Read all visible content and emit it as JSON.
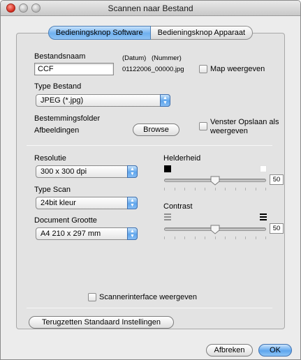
{
  "window": {
    "title": "Scannen naar Bestand"
  },
  "tabs": [
    {
      "label": "Bedieningsknop Software",
      "selected": true
    },
    {
      "label": "Bedieningsknop Apparaat",
      "selected": false
    }
  ],
  "file": {
    "name_label": "Bestandsnaam",
    "name_value": "CCF",
    "date_label": "(Datum)",
    "number_label": "(Nummer)",
    "example_filename": "01122006_00000.jpg",
    "show_folder_label": "Map weergeven",
    "show_folder_checked": false
  },
  "file_type": {
    "label": "Type Bestand",
    "selected": "JPEG (*.jpg)"
  },
  "destination": {
    "label": "Bestemmingsfolder",
    "folder": "Afbeeldingen",
    "browse_label": "Browse",
    "show_save_label_line1": "Venster Opslaan als",
    "show_save_label_line2": "weergeven",
    "show_save_checked": false
  },
  "resolution": {
    "label": "Resolutie",
    "selected": "300 x 300 dpi"
  },
  "scan_type": {
    "label": "Type Scan",
    "selected": "24bit kleur"
  },
  "document_size": {
    "label": "Document Grootte",
    "selected": "A4  210 x 297 mm"
  },
  "brightness": {
    "label": "Helderheid",
    "value": "50",
    "min": 0,
    "max": 100,
    "icon_low": "black-square-icon",
    "icon_high": "white-square-icon"
  },
  "contrast": {
    "label": "Contrast",
    "value": "50",
    "min": 0,
    "max": 100,
    "icon_low": "low-contrast-icon",
    "icon_high": "high-contrast-icon"
  },
  "scanner_interface": {
    "label": "Scannerinterface weergeven",
    "checked": false
  },
  "reset_label": "Terugzetten Standaard Instellingen",
  "buttons": {
    "cancel": "Afbreken",
    "ok": "OK"
  }
}
